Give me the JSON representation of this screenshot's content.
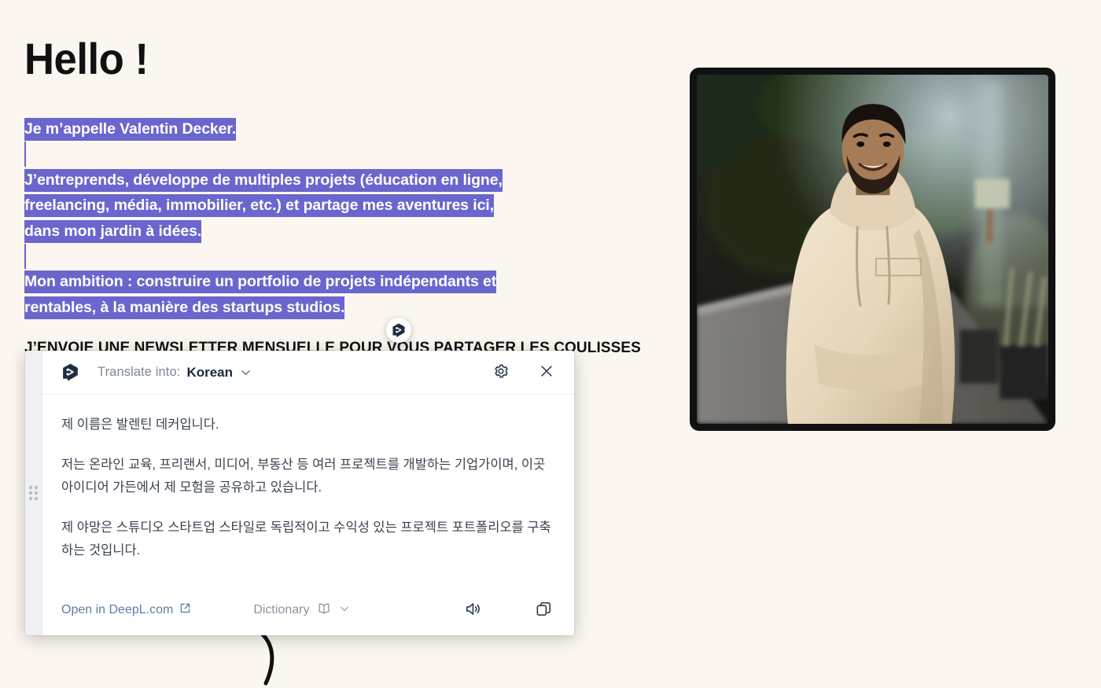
{
  "page": {
    "background_color": "#FBF6EF",
    "title": "Hello !",
    "selection_highlight_color": "#6A66CD",
    "paragraphs": [
      "Je m’appelle Valentin Decker.",
      "J’entreprends, développe de multiples projets (éducation en ligne, freelancing, média, immobilier, etc.) et partage mes aventures ici, dans mon jardin à idées.",
      "Mon ambition : construire un portfolio de projets indépendants et rentables, à la manière des startups studios."
    ],
    "newsletter_heading": "J’ENVOIE UNE NEWSLETTER MENSUELLE POUR VOUS PARTAGER LES COULISSES",
    "photo_alt": "Portrait photo of a smiling bearded man in a cream hoodie standing on a tree-lined path"
  },
  "floating_button": {
    "icon": "deepl-logo-icon",
    "label": "DeepL translate"
  },
  "popup": {
    "logo_icon": "deepl-logo-icon",
    "drag_handle_icon": "drag-handle-icon",
    "header": {
      "translate_label": "Translate into:",
      "target_language": "Korean",
      "language_chevron_icon": "chevron-down-icon",
      "settings_icon": "gear-icon",
      "settings_label": "Settings",
      "close_icon": "close-icon",
      "close_label": "Close"
    },
    "translation": [
      "제 이름은 발렌틴 데커입니다.",
      "저는 온라인 교육, 프리랜서, 미디어, 부동산 등 여러 프로젝트를 개발하는 기업가이며, 이곳 아이디어 가든에서 제 모험을 공유하고 있습니다.",
      "제 야망은 스튜디오 스타트업 스타일로 독립적이고 수익성 있는 프로젝트 포트폴리오를 구축하는 것입니다."
    ],
    "footer": {
      "open_link_label": "Open in DeepL.com",
      "open_link_icon": "external-link-icon",
      "dictionary_label": "Dictionary",
      "dictionary_icon": "book-icon",
      "dictionary_chevron_icon": "chevron-down-icon",
      "speak_icon": "speaker-icon",
      "speak_label": "Listen",
      "copy_icon": "copy-icon",
      "copy_label": "Copy to clipboard"
    },
    "colors": {
      "link": "#5D7FA3",
      "muted_text": "#8A939F",
      "body_text": "#3A4250",
      "logo": "#1F2E45"
    }
  }
}
